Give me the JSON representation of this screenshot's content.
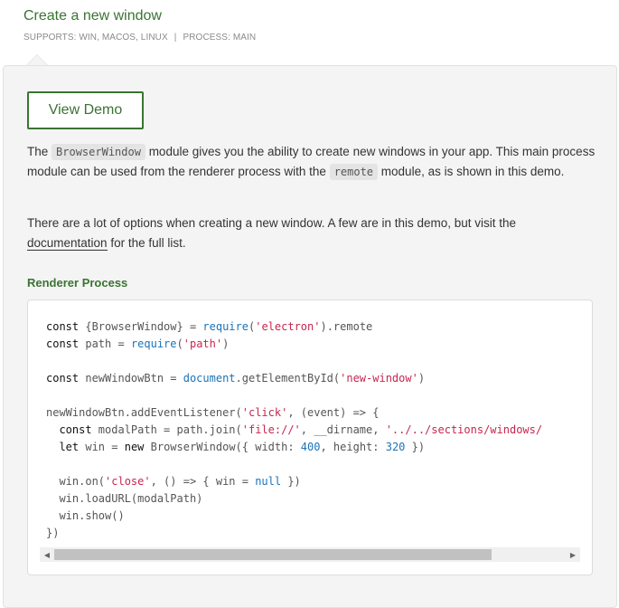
{
  "header": {
    "title": "Create a new window",
    "supports": "SUPPORTS: WIN, MACOS, LINUX",
    "separator": "|",
    "process": "PROCESS: MAIN"
  },
  "demo_button_label": "View Demo",
  "intro": {
    "t1": "The ",
    "code1": "BrowserWindow",
    "t2": " module gives you the ability to create new windows in your app. This main process module can be used from the renderer process with the ",
    "code2": "remote",
    "t3": " module, as is shown in this demo."
  },
  "options": {
    "t1": "There are a lot of options when creating a new window. A few are in this demo, but visit the ",
    "link": "documentation",
    "t2": " for the full list."
  },
  "renderer_label": "Renderer Process",
  "code": {
    "l1a": "const ",
    "l1b": "{BrowserWindow} = ",
    "l1c": "require",
    "l1d": "(",
    "l1e": "'electron'",
    "l1f": ").remote",
    "l2a": "const ",
    "l2b": "path = ",
    "l2c": "require",
    "l2d": "(",
    "l2e": "'path'",
    "l2f": ")",
    "l4a": "const ",
    "l4b": "newWindowBtn = ",
    "l4c": "document",
    "l4d": ".getElementById(",
    "l4e": "'new-window'",
    "l4f": ")",
    "l6a": "newWindowBtn.addEventListener(",
    "l6b": "'click'",
    "l6c": ", (event) => {",
    "l7a": "  const ",
    "l7b": "modalPath = path.join(",
    "l7c": "'file://'",
    "l7d": ", __dirname, ",
    "l7e": "'../../sections/windows/",
    "l8a": "  let ",
    "l8b": "win = ",
    "l8c": "new ",
    "l8d": "BrowserWindow({ width: ",
    "l8e": "400",
    "l8f": ", height: ",
    "l8g": "320",
    "l8h": " })",
    "l10a": "  win.on(",
    "l10b": "'close'",
    "l10c": ", () => { win = ",
    "l10d": "null",
    "l10e": " })",
    "l11": "  win.loadURL(modalPath)",
    "l12": "  win.show()",
    "l13": "})"
  },
  "scrollbar": {
    "left_arrow": "◀",
    "right_arrow": "▶"
  },
  "colors": {
    "accent": "#3a7332",
    "panel_bg": "#f4f4f4",
    "string": "#c7254e",
    "builtin": "#1a73b8"
  }
}
